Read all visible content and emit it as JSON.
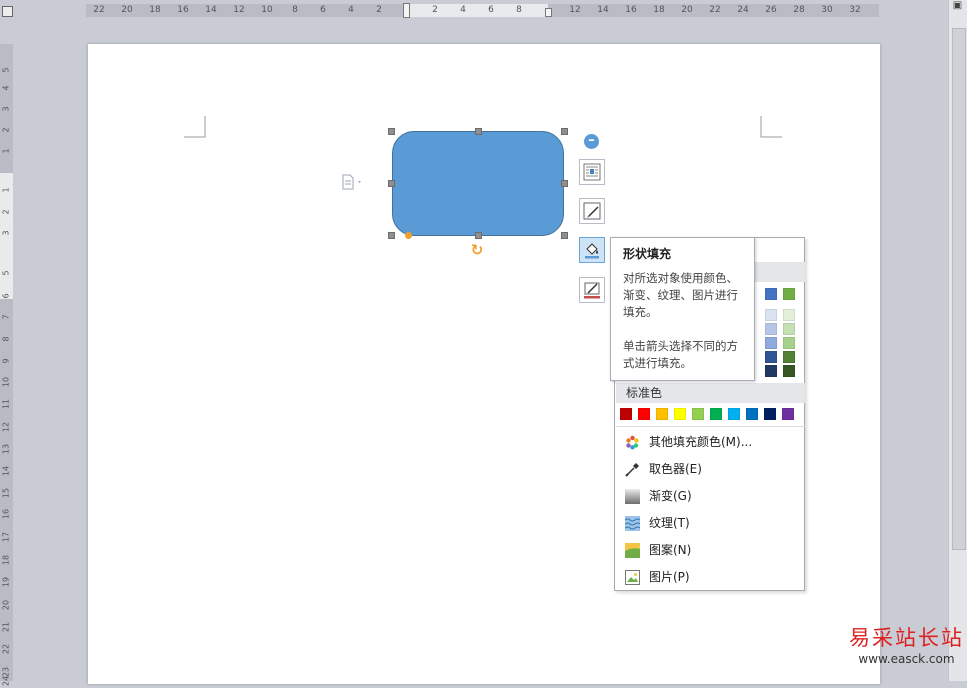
{
  "ruler": {
    "h_ticks": [
      "22",
      "20",
      "18",
      "16",
      "14",
      "12",
      "10",
      "8",
      "6",
      "4",
      "2",
      "2",
      "4",
      "6",
      "8",
      "12",
      "14",
      "16",
      "18",
      "20",
      "22",
      "24",
      "26",
      "28",
      "30",
      "32"
    ],
    "v_ticks": [
      "5",
      "4",
      "3",
      "2",
      "1",
      "1",
      "2",
      "3",
      "5",
      "6",
      "7",
      "8",
      "9",
      "10",
      "11",
      "12",
      "13",
      "14",
      "15",
      "16",
      "17",
      "18",
      "19",
      "20",
      "21",
      "22",
      "23",
      "24"
    ]
  },
  "shape": {
    "fill_color": "#5b9bd5",
    "border_color": "#41719c"
  },
  "toolbar": {
    "collapse_icon": "minus-circle-icon",
    "buttons": [
      "layout-options-icon",
      "shape-style-icon",
      "shape-fill-icon",
      "shape-outline-icon"
    ]
  },
  "tooltip": {
    "title": "形状填充",
    "para1": "对所选对象使用颜色、渐变、纹理、图片进行填充。",
    "para2": "单击箭头选择不同的方式进行填充。"
  },
  "menu": {
    "standard_colors_label": "标准色",
    "theme_row1_colors": [
      "#4472c4",
      "#70ad47"
    ],
    "theme_tint_colors": [
      [
        "#dae3f3",
        "#e2efd9"
      ],
      [
        "#b4c7e7",
        "#c5e0b3"
      ],
      [
        "#8faadc",
        "#a8d08d"
      ],
      [
        "#2f5597",
        "#538135"
      ],
      [
        "#203864",
        "#375623"
      ]
    ],
    "standard_colors": [
      "#c00000",
      "#ff0000",
      "#ffc000",
      "#ffff00",
      "#92d050",
      "#00b050",
      "#00b0f0",
      "#0070c0",
      "#002060",
      "#7030a0"
    ],
    "items": [
      {
        "label": "其他填充颜色(M)...",
        "icon": "color-wheel-icon"
      },
      {
        "label": "取色器(E)",
        "icon": "eyedropper-icon"
      },
      {
        "label": "渐变(G)",
        "icon": "gradient-icon"
      },
      {
        "label": "纹理(T)",
        "icon": "texture-icon"
      },
      {
        "label": "图案(N)",
        "icon": "pattern-icon"
      },
      {
        "label": "图片(P)",
        "icon": "picture-icon"
      }
    ]
  },
  "watermark": {
    "text": "易采站长站",
    "url": "www.easck.com"
  }
}
